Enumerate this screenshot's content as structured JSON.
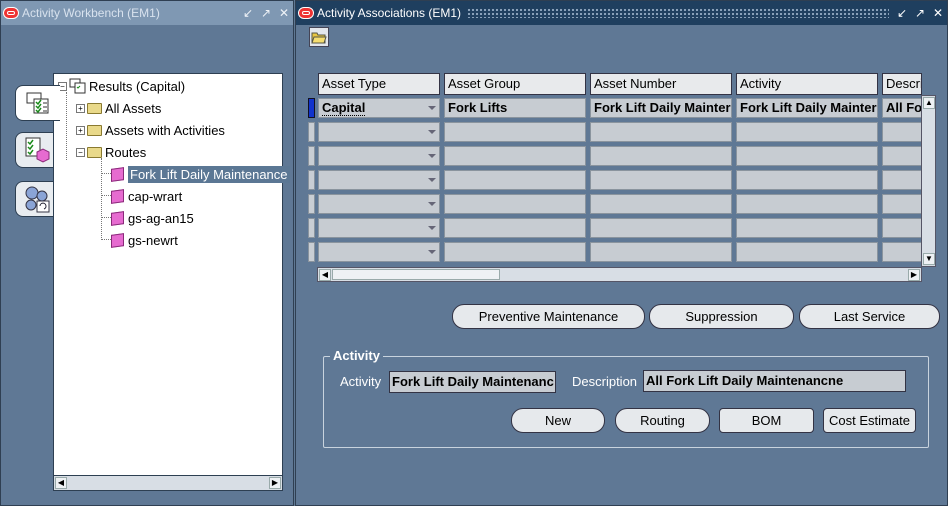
{
  "left_window": {
    "title": "Activity Workbench (EM1)",
    "tabs": [
      {
        "icon": "results-list-icon"
      },
      {
        "icon": "activity-checklist-icon"
      },
      {
        "icon": "refresh-routing-icon"
      }
    ],
    "tree": {
      "root": "Results (Capital)",
      "folders": [
        "All Assets",
        "Assets with Activities",
        "Routes"
      ],
      "routes": [
        "Fork Lift Daily Maintenance",
        "cap-wrart",
        "gs-ag-an15",
        "gs-newrt"
      ],
      "selected": "Fork Lift Daily Maintenance"
    }
  },
  "right_window": {
    "title": "Activity Associations (EM1)",
    "grid": {
      "columns": [
        "Asset Type",
        "Asset Group",
        "Asset Number",
        "Activity",
        "Descri"
      ],
      "rows": [
        [
          "Capital",
          "Fork Lifts",
          "Fork Lift Daily Mainter",
          "Fork Lift Daily Mainter",
          "All Fo"
        ]
      ]
    },
    "buttons": {
      "preventive": "Preventive Maintenance",
      "suppression": "Suppression",
      "last_service": "Last Service"
    },
    "activity_group": {
      "title": "Activity",
      "activity_label": "Activity",
      "activity_value": "Fork Lift Daily Maintenanc",
      "description_label": "Description",
      "description_value": "All Fork Lift Daily Maintenancne"
    },
    "action_buttons": {
      "new": "New",
      "routing": "Routing",
      "bom": "BOM",
      "cost_estimate": "Cost Estimate"
    }
  },
  "colors": {
    "background": "#5f7893",
    "active_title": "#1f3f5f",
    "selection": "#5b7794",
    "record_indicator": "#1133cc"
  }
}
